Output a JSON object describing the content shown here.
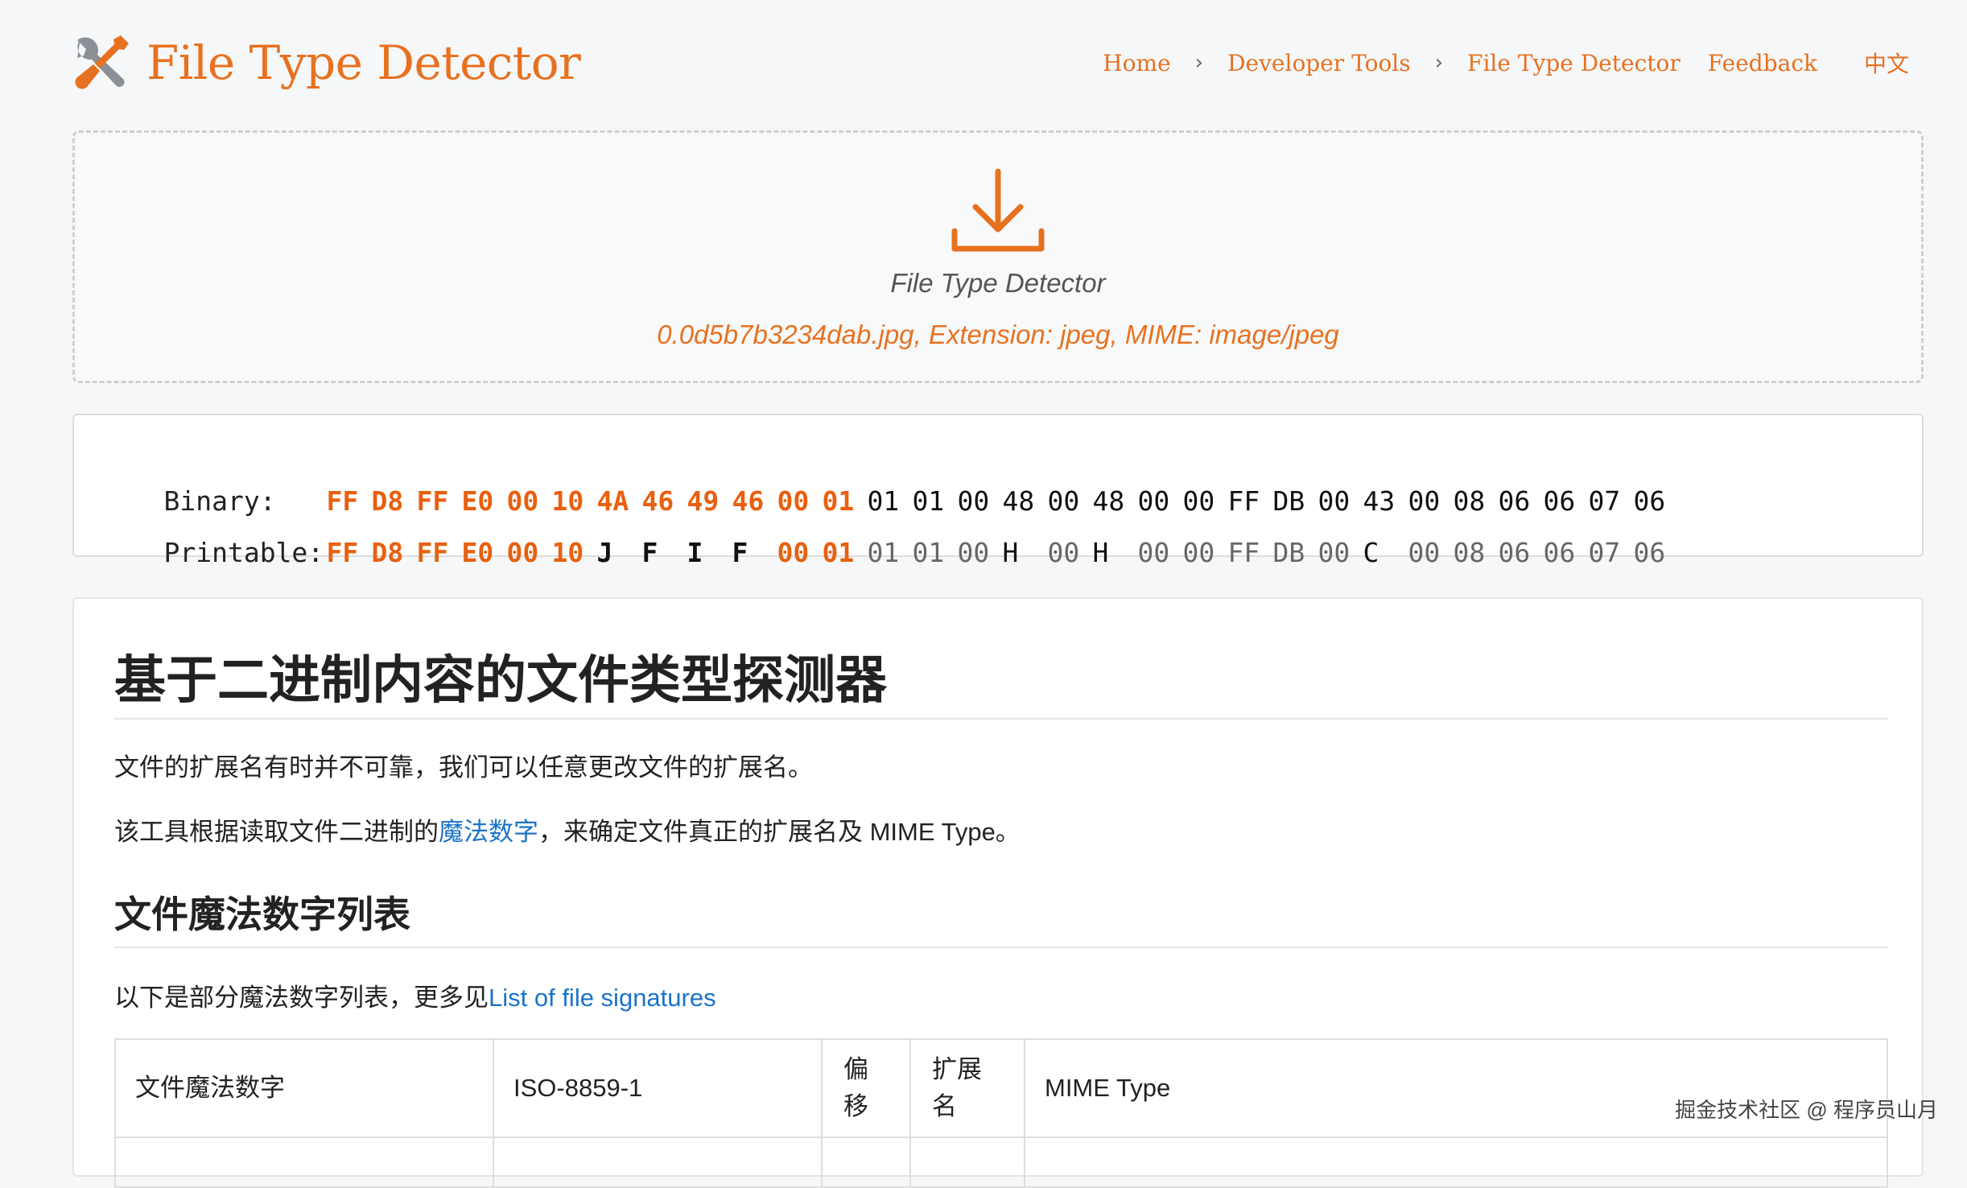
{
  "header": {
    "logo_title": "File Type Detector",
    "nav": {
      "home": "Home",
      "developer_tools": "Developer Tools",
      "file_type_detector": "File Type Detector",
      "feedback": "Feedback",
      "language": "中文"
    },
    "separator": "›"
  },
  "dropzone": {
    "title": "File Type Detector",
    "result": "0.0d5b7b3234dab.jpg, Extension: jpeg, MIME: image/jpeg",
    "icon": "download-icon"
  },
  "binary": {
    "binary_label": "Binary:",
    "printable_label": "Printable:",
    "binary_bytes": [
      "FF",
      "D8",
      "FF",
      "E0",
      "00",
      "10",
      "4A",
      "46",
      "49",
      "46",
      "00",
      "01",
      "01",
      "01",
      "00",
      "48",
      "00",
      "48",
      "00",
      "00",
      "FF",
      "DB",
      "00",
      "43",
      "00",
      "08",
      "06",
      "06",
      "07",
      "06"
    ],
    "printable_bytes": [
      "FF",
      "D8",
      "FF",
      "E0",
      "00",
      "10",
      "J",
      "F",
      "I",
      "F",
      "00",
      "01",
      "01",
      "01",
      "00",
      "H",
      "00",
      "H",
      "00",
      "00",
      "FF",
      "DB",
      "00",
      "C",
      "00",
      "08",
      "06",
      "06",
      "07",
      "06"
    ],
    "highlight_count": 12
  },
  "content": {
    "heading": "基于二进制内容的文件类型探测器",
    "para1": "文件的扩展名有时并不可靠，我们可以任意更改文件的扩展名。",
    "para2_before": "该工具根据读取文件二进制的",
    "para2_link": "魔法数字",
    "para2_after": "，来确定文件真正的扩展名及 MIME Type。",
    "subheading": "文件魔法数字列表",
    "para3_before": "以下是部分魔法数字列表，更多见",
    "para3_link": "List of file signatures",
    "table_headers": [
      "文件魔法数字",
      "ISO-8859-1",
      "偏移",
      "扩展名",
      "MIME Type"
    ]
  },
  "watermark": "掘金技术社区 @ 程序员山月",
  "colors": {
    "accent": "#e8711f",
    "highlight": "#e8600f",
    "link": "#1a73c9",
    "background": "#f6f7f9"
  }
}
